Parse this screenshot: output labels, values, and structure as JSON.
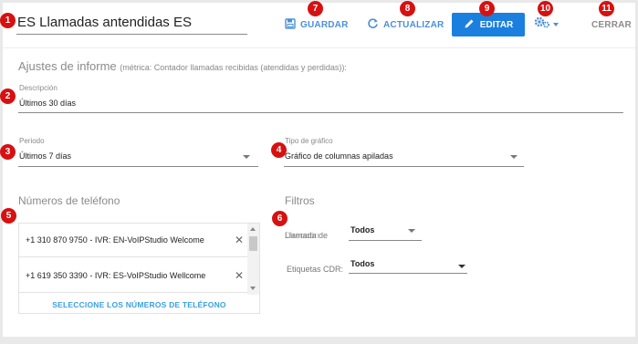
{
  "header": {
    "report_title": "ES Llamadas antendidas ES",
    "save_label": "GUARDAR",
    "refresh_label": "ACTUALIZAR",
    "edit_label": "EDITAR",
    "close_label": "CERRAR"
  },
  "badges": [
    "1",
    "2",
    "3",
    "4",
    "5",
    "6",
    "7",
    "8",
    "9",
    "10",
    "11"
  ],
  "settings": {
    "section_title": "Ajustes de informe",
    "metric_note": "(métrica: Contador llamadas recibidas (atendidas y perdidas)):",
    "description_label": "Descripción",
    "description_value": "Últimos 30 días",
    "period_label": "Periodo",
    "period_value": "Últimos 7 días",
    "chart_type_label": "Tipo de gráfico",
    "chart_type_value": "Gráfico de columnas apiladas"
  },
  "phones": {
    "title": "Números de teléfono",
    "items": [
      "+1 310 870 9750 - IVR: EN-VoIPStudio Welcome",
      "+1 619 350 3390 - IVR: ES-VoIPStudio Wellcome"
    ],
    "remove_glyph": "✕",
    "select_label": "SELECCIONE LOS NÚMEROS DE TELÉFONO"
  },
  "filters": {
    "title": "Filtros",
    "filter1_label": "Llamada de",
    "filter1_label_overlay": "Dirección",
    "filter1_value": "Todos",
    "filter2_label": "Etiquetas CDR:",
    "filter2_value": "Todos"
  },
  "colors": {
    "accent": "#1b7fe0",
    "link": "#4a90d9",
    "badge": "#d61111"
  },
  "icons": [
    "save-icon",
    "refresh-icon",
    "pencil-icon",
    "gear-icon",
    "chevron-down-icon",
    "close-icon"
  ]
}
